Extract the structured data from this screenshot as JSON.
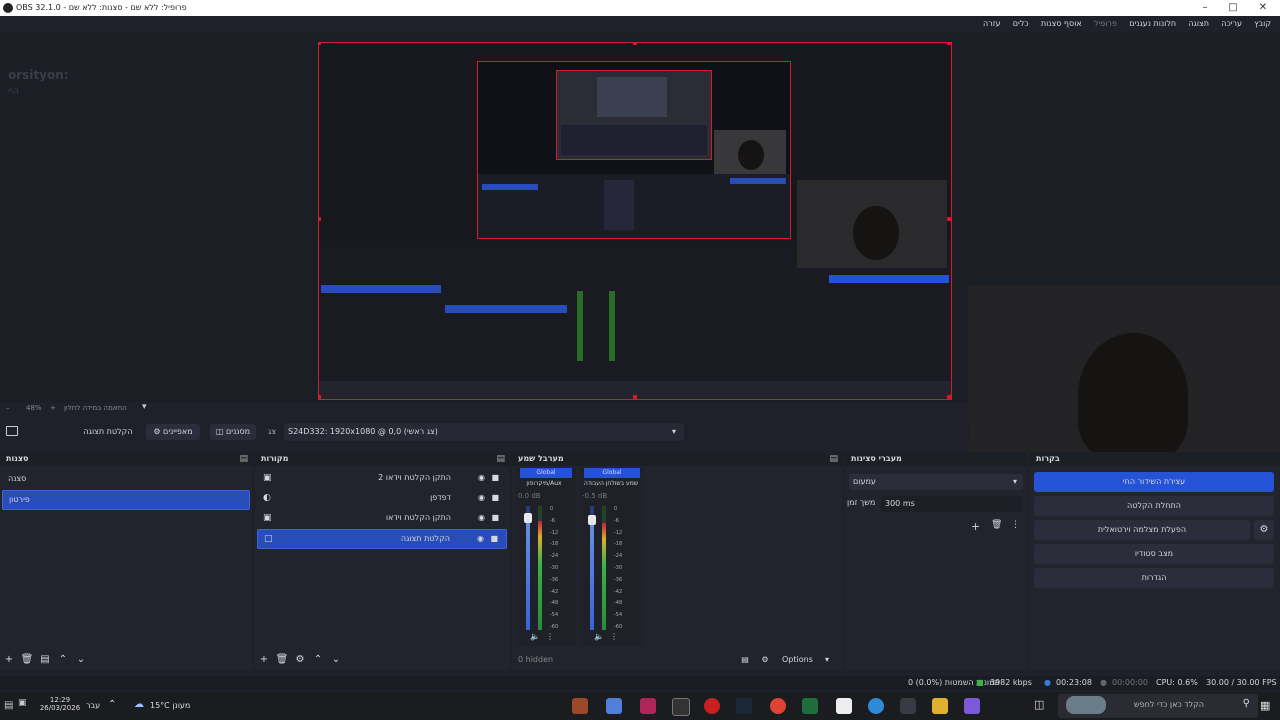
{
  "window": {
    "title": "OBS 32.1.0 - פרופיל: ללא שם - סצנות: ללא שם"
  },
  "menu": [
    "קובץ",
    "עריכה",
    "תצוגה",
    "חלונות נעגנים",
    "פרופיל",
    "אוסף סצנות",
    "כלים",
    "עזרה"
  ],
  "ghost_text": {
    "line1": "orsityon:",
    "line2": "היי"
  },
  "preview": {
    "zoom": "48%",
    "zoom_label": "התאמה במידה לחלון"
  },
  "toolbar": {
    "source_props": "הקלטת תצוגה",
    "properties": "מאפיינים",
    "filters": "מסננים",
    "scene_label": "צג",
    "display_select": "S24D332: 1920x1080 @ 0,0 (צג ראשי)"
  },
  "scenes": {
    "title": "סצנות",
    "items": [
      "סצנה",
      "פירטון"
    ],
    "selected": 1
  },
  "sources": {
    "title": "מקורות",
    "items": [
      {
        "label": "התקן הקלטת וידאו 2",
        "icon": "camera-icon"
      },
      {
        "label": "דפדפן",
        "icon": "globe-icon"
      },
      {
        "label": "התקן הקלטת וידאו",
        "icon": "camera-icon"
      },
      {
        "label": "הקלטת תצוגה",
        "icon": "monitor-icon"
      }
    ],
    "selected": 3
  },
  "mixer": {
    "title": "מערבל שמע",
    "channels": [
      {
        "tag": "Global",
        "name": "מיקרופון/Aux",
        "db": "0.0 dB",
        "level": 0.88
      },
      {
        "tag": "Global",
        "name": "שמע בשולחן העבודה",
        "db": "-0.5 dB",
        "level": 0.86
      }
    ],
    "scale": [
      "0",
      "-6",
      "-12",
      "-18",
      "-24",
      "-30",
      "-36",
      "-42",
      "-48",
      "-54",
      "-60"
    ],
    "hidden": "0 hidden",
    "options": "Options"
  },
  "transitions": {
    "title": "מעברי סצינות",
    "type": "עמעום",
    "duration_label": "משך זמן",
    "duration": "300 ms"
  },
  "controls": {
    "title": "בקרות",
    "buttons": [
      "עצירת השידור החי",
      "התחלת הקלטה",
      "הפעלת מצלמה וירטואלית",
      "מצב סטודיו",
      "הגדרות"
    ]
  },
  "status": {
    "dropped": "0 תמונות השמטות (0.0%)",
    "bitrate": "3982 kbps",
    "stream_time": "00:23:08",
    "rec_time": "00:00:00",
    "cpu": "CPU: 0.6%",
    "fps": "30.00 / 30.00 FPS"
  },
  "taskbar": {
    "time": "12:29",
    "date": "26/03/2026",
    "lang": "עבר",
    "weather": "15°C מעונן",
    "search": "הקלד כאן כדי לחפש"
  },
  "colors": {
    "accent": "#284cb8",
    "button_primary": "#2553d6",
    "selection_border": "#d61c2c"
  }
}
